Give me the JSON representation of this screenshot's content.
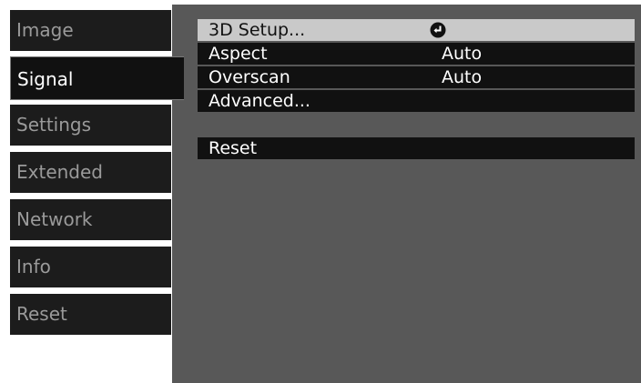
{
  "sidebar": {
    "tabs": [
      {
        "label": "Image"
      },
      {
        "label": "Signal"
      },
      {
        "label": "Settings"
      },
      {
        "label": "Extended"
      },
      {
        "label": "Network"
      },
      {
        "label": "Info"
      },
      {
        "label": "Reset"
      }
    ],
    "active_tab": "Signal"
  },
  "panel": {
    "items": [
      {
        "label": "3D Setup...",
        "icon": "enter-icon"
      },
      {
        "label": "Aspect",
        "value": "Auto"
      },
      {
        "label": "Overscan",
        "value": "Auto"
      },
      {
        "label": "Advanced..."
      },
      {
        "label": "Reset"
      }
    ],
    "selected_item": "3D Setup..."
  },
  "colors": {
    "tab_bg": "#1c1c1c",
    "tab_text": "#9a9a9a",
    "active_tab_text": "#ffffff",
    "panel_bg": "#585858",
    "row_bg": "#111111",
    "selected_row_bg": "#c9c9c9"
  }
}
